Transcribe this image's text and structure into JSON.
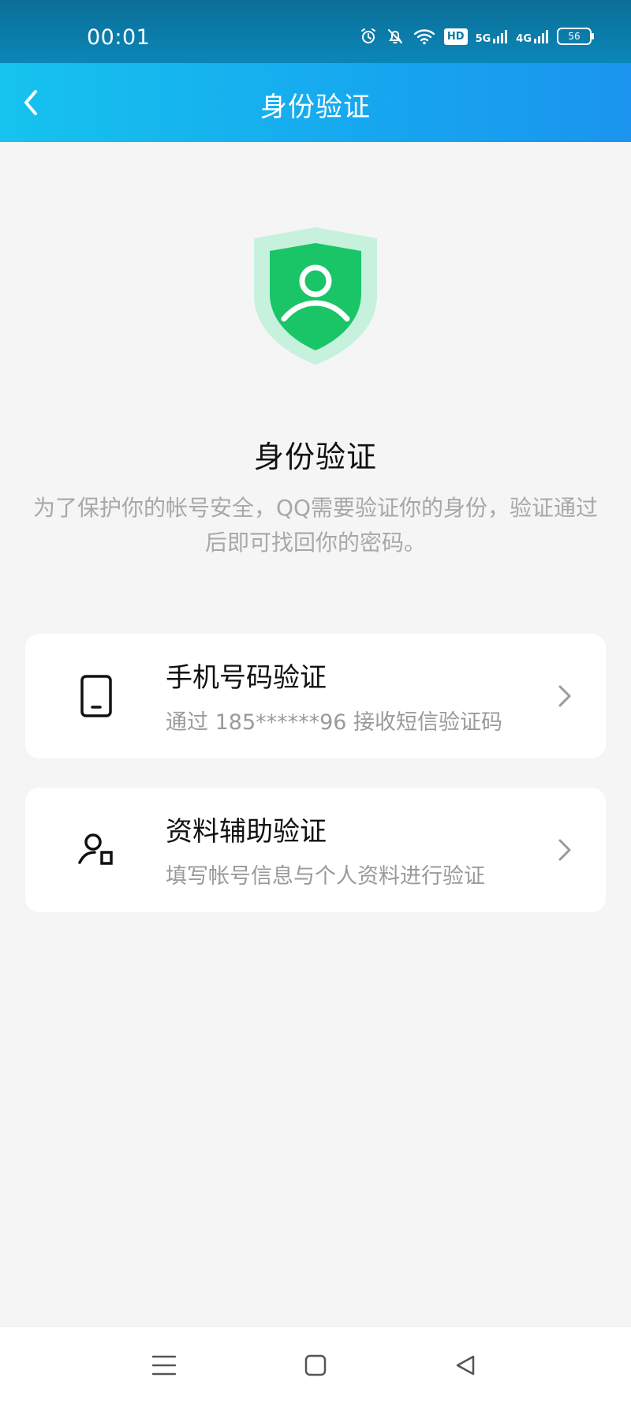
{
  "status_bar": {
    "time": "00:01",
    "hd_label": "HD",
    "network_5g_label": "5G",
    "network_4g_label": "4G",
    "battery_label": "56",
    "icons": [
      "alarm-icon",
      "bell-off-icon",
      "wifi-icon",
      "hd-icon",
      "signal-5g-icon",
      "signal-4g-icon",
      "battery-icon"
    ]
  },
  "header": {
    "title": "身份验证",
    "back_icon": "chevron-left-icon"
  },
  "hero": {
    "icon": "shield-user-icon",
    "title": "身份验证",
    "description": "为了保护你的帐号安全，QQ需要验证你的身份，验证通过后即可找回你的密码。",
    "colors": {
      "shield_light": "#c6f1dc",
      "shield_dark": "#19c567",
      "shield_inner": "#ffffff"
    }
  },
  "options": [
    {
      "icon": "phone-icon",
      "title": "手机号码验证",
      "subtitle": "通过 185******96 接收短信验证码"
    },
    {
      "icon": "user-profile-icon",
      "title": "资料辅助验证",
      "subtitle": "填写帐号信息与个人资料进行验证"
    }
  ],
  "bottom_nav": {
    "icons": [
      "menu-icon",
      "home-square-icon",
      "back-triangle-icon"
    ]
  },
  "colors": {
    "accent": "#16a9ef",
    "background": "#f5f5f5",
    "card": "#ffffff",
    "primary_text": "#111111",
    "secondary_text": "#9a9a9a"
  }
}
